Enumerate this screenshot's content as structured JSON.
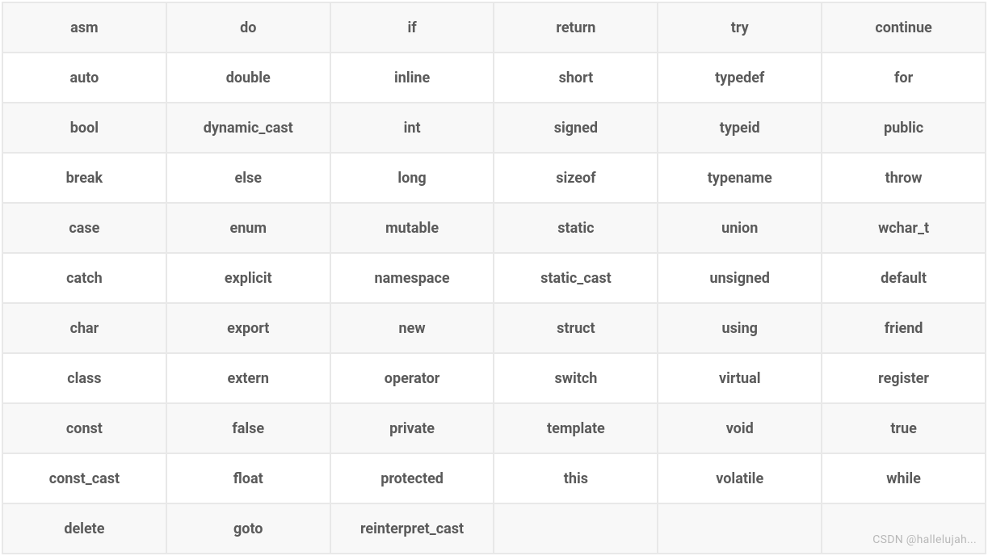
{
  "table": {
    "rows": [
      [
        "asm",
        "do",
        "if",
        "return",
        "try",
        "continue"
      ],
      [
        "auto",
        "double",
        "inline",
        "short",
        "typedef",
        "for"
      ],
      [
        "bool",
        "dynamic_cast",
        "int",
        "signed",
        "typeid",
        "public"
      ],
      [
        "break",
        "else",
        "long",
        "sizeof",
        "typename",
        "throw"
      ],
      [
        "case",
        "enum",
        "mutable",
        "static",
        "union",
        "wchar_t"
      ],
      [
        "catch",
        "explicit",
        "namespace",
        "static_cast",
        "unsigned",
        "default"
      ],
      [
        "char",
        "export",
        "new",
        "struct",
        "using",
        "friend"
      ],
      [
        "class",
        "extern",
        "operator",
        "switch",
        "virtual",
        "register"
      ],
      [
        "const",
        "false",
        "private",
        "template",
        "void",
        "true"
      ],
      [
        "const_cast",
        "float",
        "protected",
        "this",
        "volatile",
        "while"
      ],
      [
        "delete",
        "goto",
        "reinterpret_cast",
        "",
        "",
        ""
      ]
    ]
  },
  "watermark": "CSDN @hallelujah..."
}
